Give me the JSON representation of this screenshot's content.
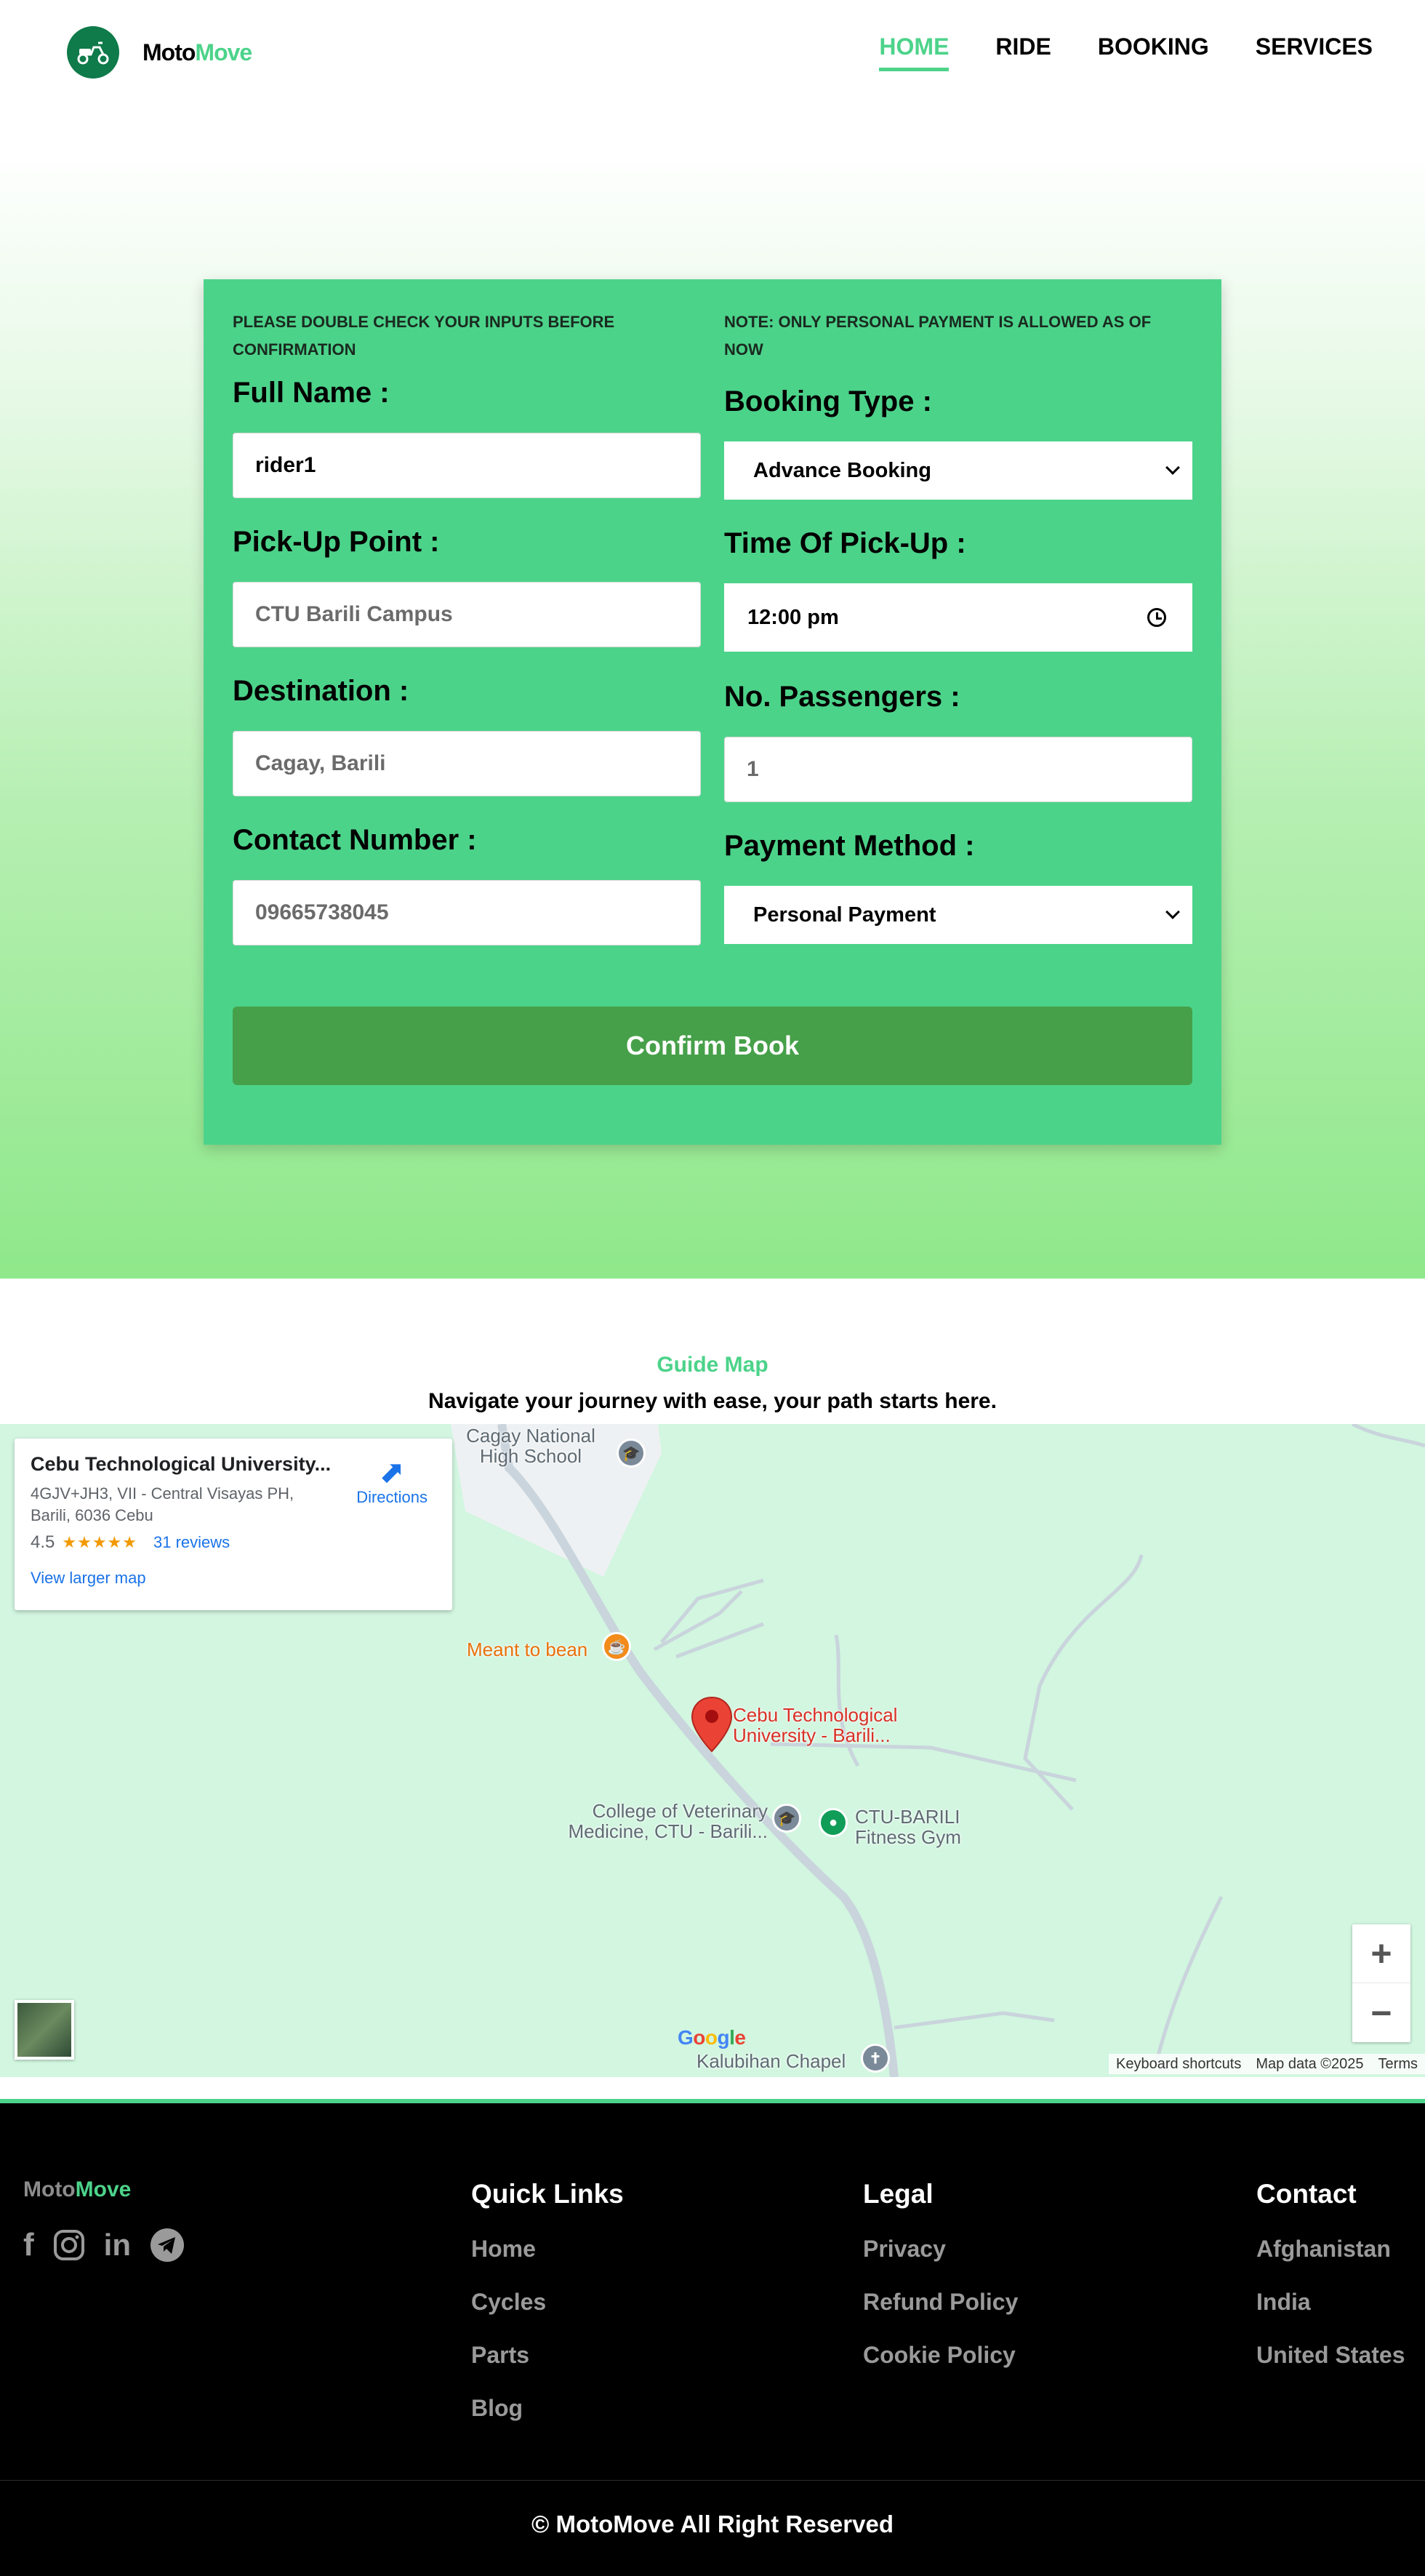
{
  "header": {
    "logo_text_1": "Moto",
    "logo_text_2": "Move",
    "nav": [
      {
        "label": "HOME",
        "active": true
      },
      {
        "label": "RIDE",
        "active": false
      },
      {
        "label": "BOOKING",
        "active": false
      },
      {
        "label": "SERVICES",
        "active": false
      }
    ]
  },
  "form": {
    "note_left": "PLEASE DOUBLE CHECK YOUR INPUTS BEFORE CONFIRMATION",
    "note_right": "NOTE: ONLY PERSONAL PAYMENT IS ALLOWED AS OF NOW",
    "full_name_label": "Full Name :",
    "full_name_value": "rider1",
    "pickup_label": "Pick-Up Point :",
    "pickup_placeholder": "CTU Barili Campus",
    "destination_label": "Destination :",
    "destination_placeholder": "Cagay, Barili",
    "contact_label": "Contact Number :",
    "contact_placeholder": "09665738045",
    "booking_type_label": "Booking Type :",
    "booking_type_value": "Advance Booking",
    "time_label": "Time Of Pick-Up :",
    "time_value": "12:00  pm",
    "passengers_label": "No. Passengers :",
    "passengers_placeholder": "1",
    "payment_label": "Payment Method :",
    "payment_value": "Personal Payment",
    "confirm_label": "Confirm Book"
  },
  "guide": {
    "title": "Guide Map",
    "subtitle": "Navigate your journey with ease, your path starts here."
  },
  "map": {
    "place_name": "Cebu Technological University...",
    "address": "4GJV+JH3, VII - Central Visayas PH, Barili, 6036 Cebu",
    "rating": "4.5",
    "stars": "★★★★★",
    "reviews": "31 reviews",
    "view_larger": "View larger map",
    "directions": "Directions",
    "labels": {
      "school": "Cagay National High School",
      "cafe": "Meant to bean",
      "university": "Cebu Technological University -  Barili...",
      "college": "College of Veterinary Medicine, CTU -  Barili...",
      "gym": "CTU-BARILI Fitness Gym",
      "chapel": "Kalubihan Chapel"
    },
    "google": "Google",
    "keyboard": "Keyboard shortcuts",
    "map_data": "Map data ©2025",
    "terms": "Terms",
    "zoom_in": "+",
    "zoom_out": "−"
  },
  "footer": {
    "logo_text_1": "Moto",
    "logo_text_2": "Move",
    "quick_links_title": "Quick Links",
    "quick_links": [
      "Home",
      "Cycles",
      "Parts",
      "Blog"
    ],
    "legal_title": "Legal",
    "legal": [
      "Privacy",
      "Refund Policy",
      "Cookie Policy"
    ],
    "contact_title": "Contact",
    "contact": [
      "Afghanistan",
      "India",
      "United States"
    ],
    "copyright": "© MotoMove All Right Reserved"
  },
  "colors": {
    "brand_green": "#4cd38a",
    "button_green": "#46a049",
    "footer_bg": "#000000"
  }
}
